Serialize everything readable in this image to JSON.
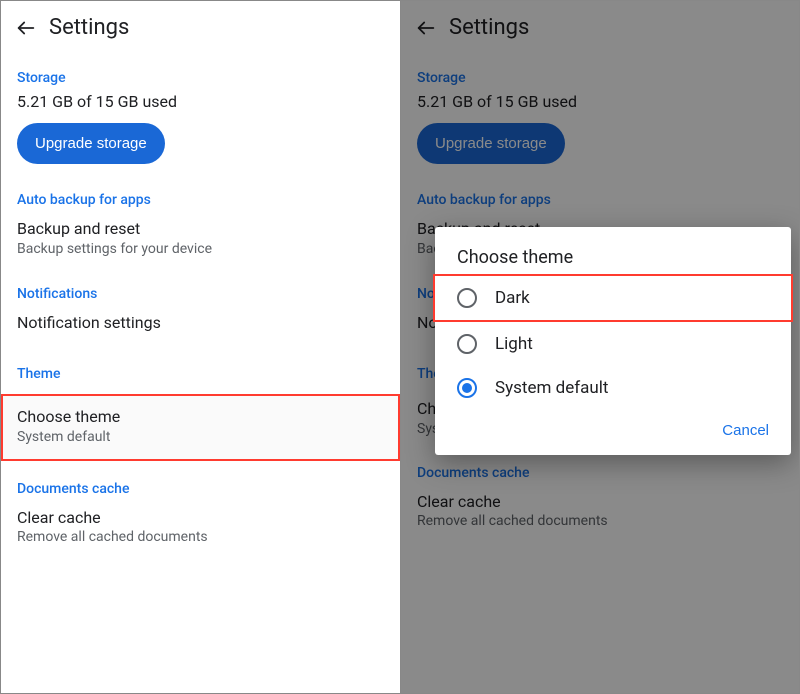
{
  "header": {
    "title": "Settings"
  },
  "storage": {
    "label": "Storage",
    "usage": "5.21 GB of 15 GB used",
    "upgrade": "Upgrade storage"
  },
  "backup": {
    "label": "Auto backup for apps",
    "title": "Backup and reset",
    "sub": "Backup settings for your device"
  },
  "notifications": {
    "label": "Notifications",
    "title": "Notification settings"
  },
  "theme": {
    "label": "Theme",
    "title": "Choose theme",
    "sub": "System default"
  },
  "cache": {
    "label": "Documents cache",
    "title": "Clear cache",
    "sub": "Remove all cached documents"
  },
  "dialog": {
    "title": "Choose theme",
    "options": {
      "dark": "Dark",
      "light": "Light",
      "system": "System default"
    },
    "cancel": "Cancel"
  }
}
